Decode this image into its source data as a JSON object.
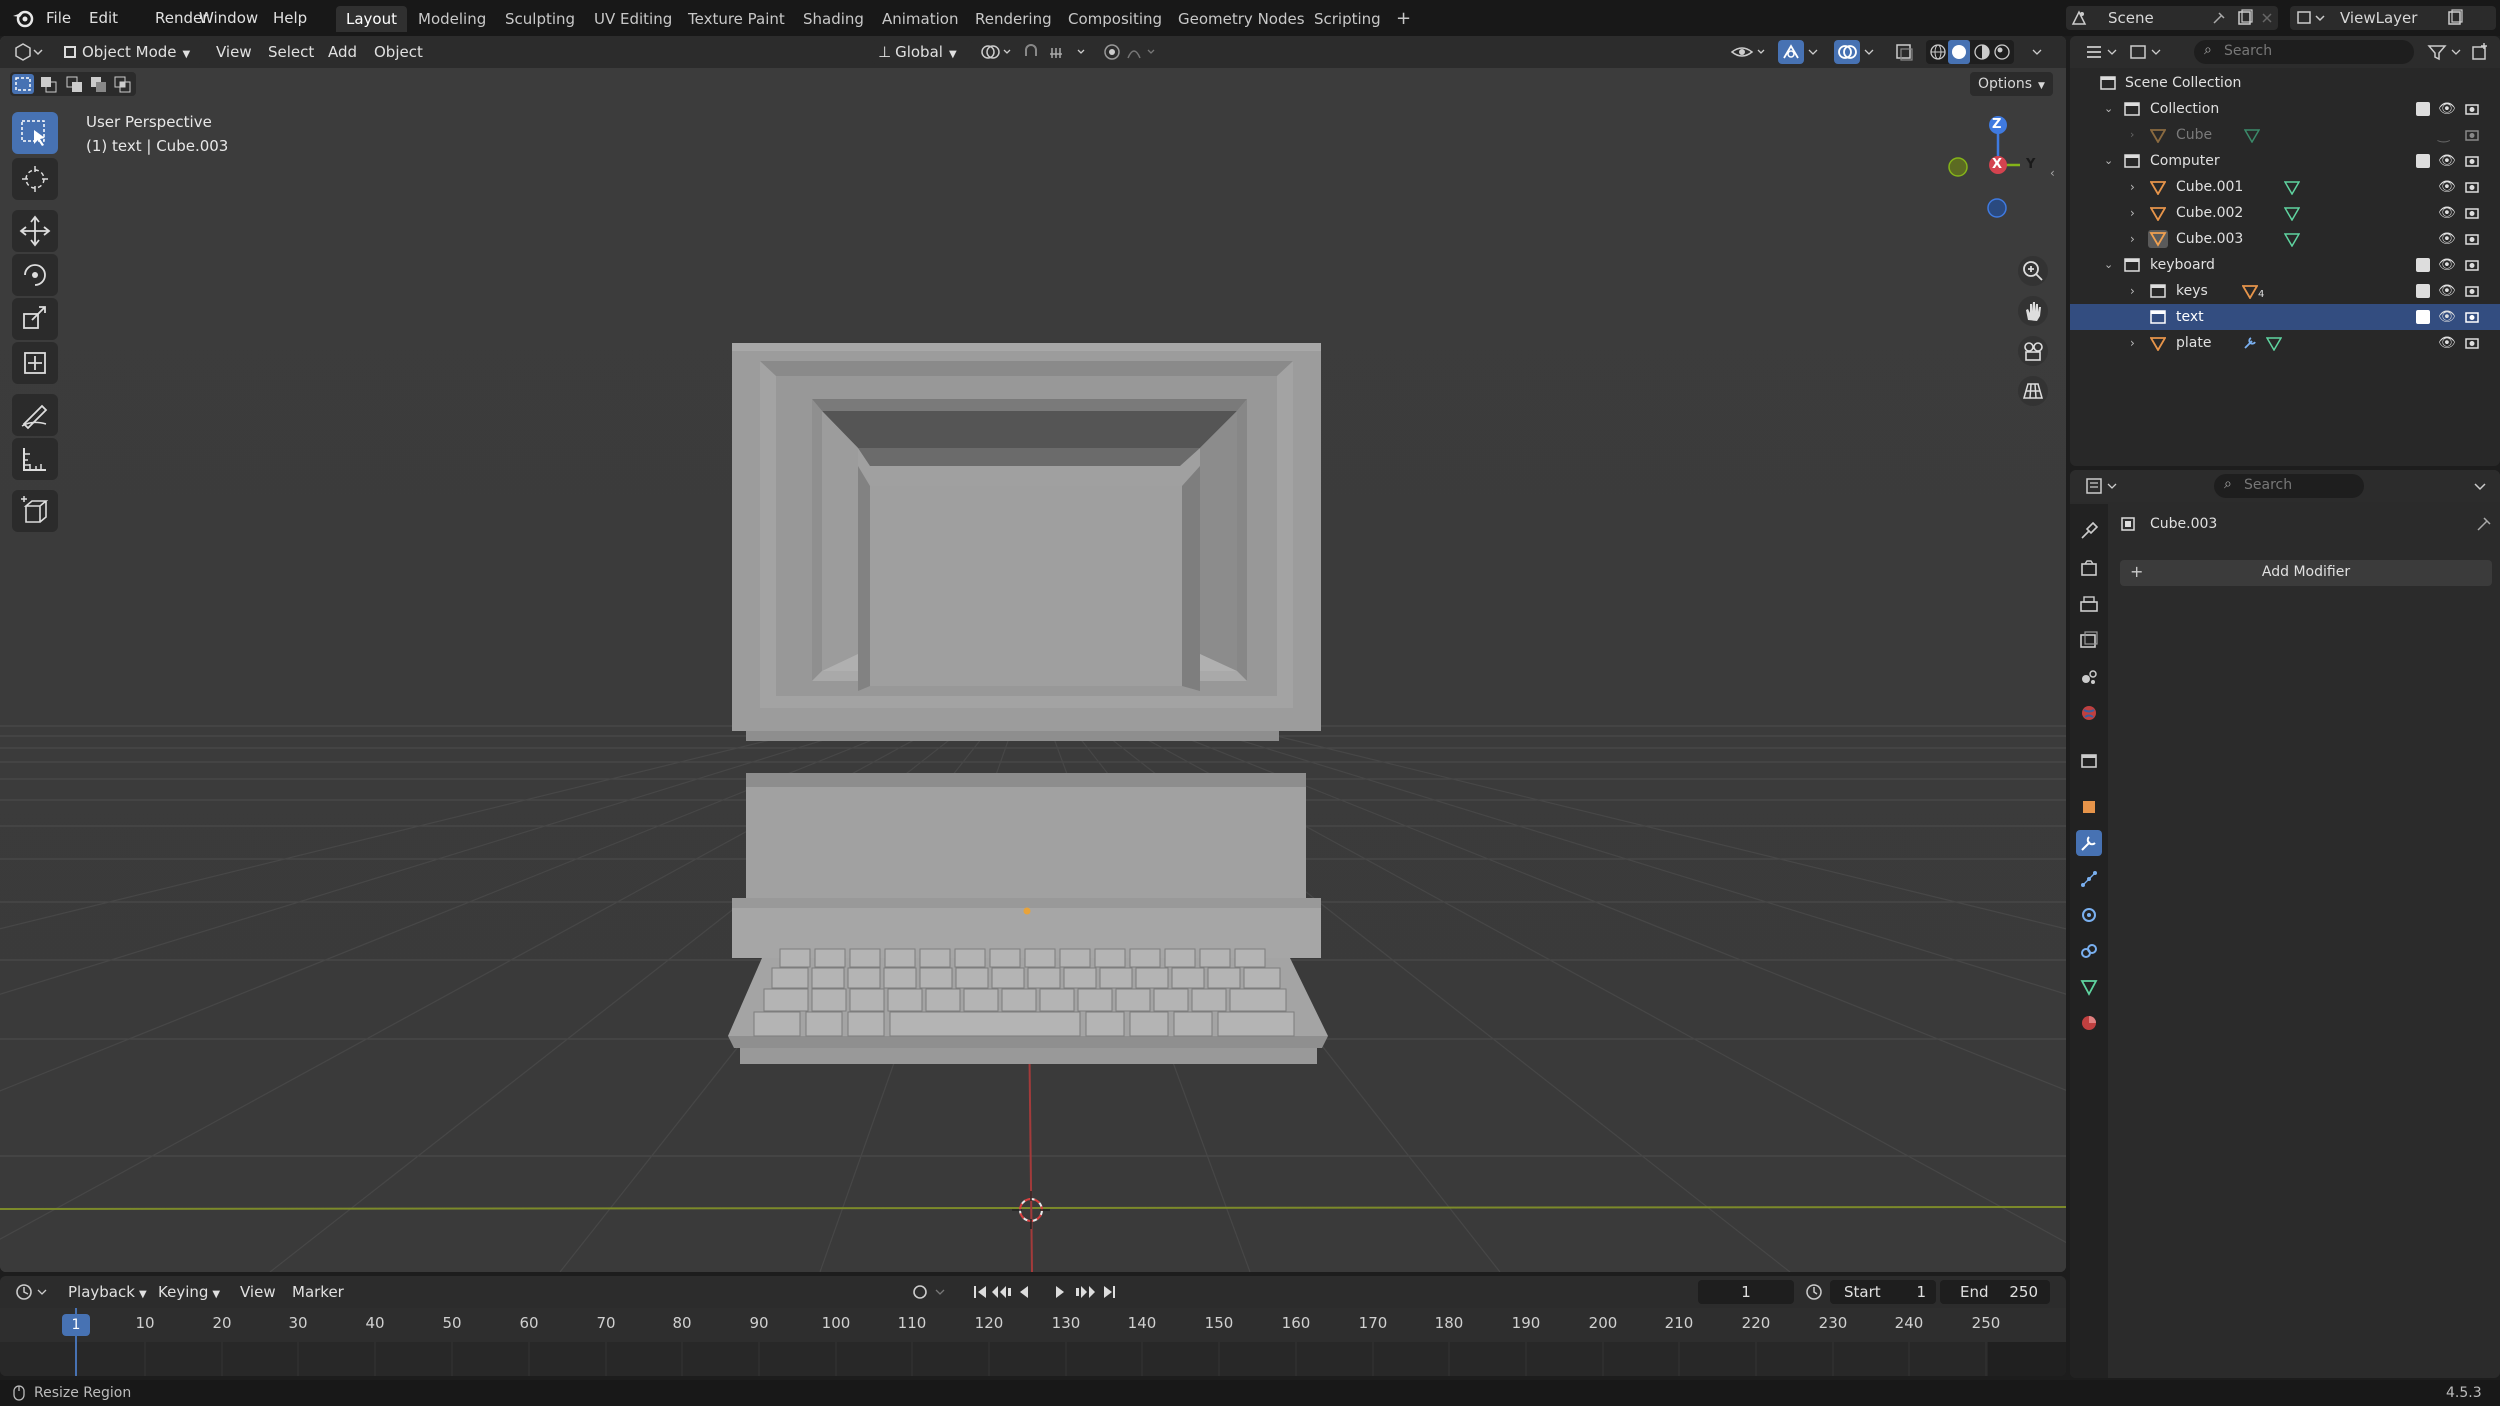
{
  "topbar": {
    "menus": [
      "File",
      "Edit",
      "Render",
      "Window",
      "Help"
    ],
    "workspaces": [
      "Layout",
      "Modeling",
      "Sculpting",
      "UV Editing",
      "Texture Paint",
      "Shading",
      "Animation",
      "Rendering",
      "Compositing",
      "Geometry Nodes",
      "Scripting"
    ],
    "active_workspace": "Layout",
    "add_tab": "+",
    "scene_name": "Scene",
    "view_layer": "ViewLayer"
  },
  "viewport": {
    "mode": "Object Mode",
    "menus": [
      "View",
      "Select",
      "Add",
      "Object"
    ],
    "transform_orientation": "Global",
    "options_label": "Options",
    "overlay_title": "User Perspective",
    "overlay_subtitle": "(1) text | Cube.003",
    "gizmo_axes": {
      "z": "Z",
      "x": "X",
      "y": "Y"
    },
    "axis_colors": {
      "x": "#d4434f",
      "y": "#84b319",
      "z": "#3f7ae0"
    }
  },
  "outliner": {
    "search_placeholder": "Search",
    "root": "Scene Collection",
    "rows": [
      {
        "label": "Collection",
        "level": 1,
        "type": "collection",
        "expanded": true
      },
      {
        "label": "Cube",
        "level": 2,
        "type": "object",
        "dim": true
      },
      {
        "label": "Computer",
        "level": 1,
        "type": "collection",
        "expanded": true
      },
      {
        "label": "Cube.001",
        "level": 2,
        "type": "object"
      },
      {
        "label": "Cube.002",
        "level": 2,
        "type": "object"
      },
      {
        "label": "Cube.003",
        "level": 2,
        "type": "object"
      },
      {
        "label": "keyboard",
        "level": 1,
        "type": "collection",
        "expanded": true
      },
      {
        "label": "keys",
        "level": 2,
        "type": "object",
        "badge": "4"
      },
      {
        "label": "text",
        "level": 2,
        "type": "collection",
        "selected": true
      },
      {
        "label": "plate",
        "level": 2,
        "type": "object"
      }
    ]
  },
  "properties": {
    "search_placeholder": "Search",
    "object_name": "Cube.003",
    "add_modifier": "Add Modifier",
    "add_icon": "+"
  },
  "timeline": {
    "menus": [
      "Playback",
      "Keying",
      "View",
      "Marker"
    ],
    "current_frame": "1",
    "start_label": "Start",
    "start_value": "1",
    "end_label": "End",
    "end_value": "250",
    "ticks": [
      "10",
      "20",
      "30",
      "40",
      "50",
      "60",
      "70",
      "80",
      "90",
      "100",
      "110",
      "120",
      "130",
      "140",
      "150",
      "160",
      "170",
      "180",
      "190",
      "200",
      "210",
      "220",
      "230",
      "240",
      "250"
    ],
    "playhead_label": "1"
  },
  "statusbar": {
    "hint": "Resize Region",
    "version": "4.5.3"
  }
}
